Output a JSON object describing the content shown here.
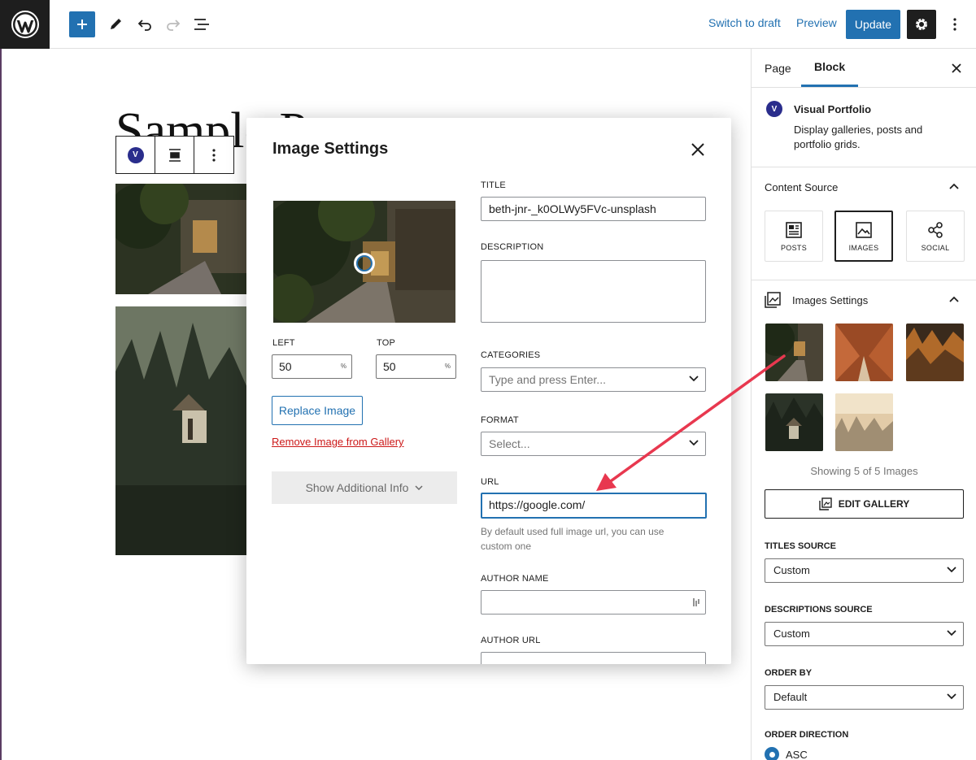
{
  "topbar": {
    "switch_to_draft": "Switch to draft",
    "preview": "Preview",
    "update": "Update"
  },
  "post": {
    "title": "Sample Post"
  },
  "modal": {
    "title": "Image Settings",
    "left_label": "LEFT",
    "left_value": "50",
    "top_label": "TOP",
    "top_value": "50",
    "unit": "%",
    "replace_button": "Replace Image",
    "remove_link": "Remove Image from Gallery",
    "additional_info_button": "Show Additional Info",
    "fields": {
      "title_label": "TITLE",
      "title_value": "beth-jnr-_k0OLWy5FVc-unsplash",
      "description_label": "DESCRIPTION",
      "description_value": "",
      "categories_label": "CATEGORIES",
      "categories_placeholder": "Type and press Enter...",
      "format_label": "FORMAT",
      "format_value": "Select...",
      "url_label": "URL",
      "url_value": "https://google.com/",
      "url_help": "By default used full image url, you can use custom one",
      "author_name_label": "AUTHOR NAME",
      "author_name_value": "",
      "author_url_label": "AUTHOR URL"
    }
  },
  "sidebar": {
    "tabs": [
      "Page",
      "Block"
    ],
    "active_tab": "Block",
    "block_name": "Visual Portfolio",
    "block_description": "Display galleries, posts and portfolio grids.",
    "content_source_heading": "Content Source",
    "sources": [
      "POSTS",
      "IMAGES",
      "SOCIAL"
    ],
    "active_source": "IMAGES",
    "images_settings_heading": "Images Settings",
    "showing_text": "Showing 5 of 5 Images",
    "edit_gallery_button": "EDIT GALLERY",
    "titles_source_label": "TITLES SOURCE",
    "titles_source_value": "Custom",
    "descriptions_source_label": "DESCRIPTIONS SOURCE",
    "descriptions_source_value": "Custom",
    "order_by_label": "ORDER BY",
    "order_by_value": "Default",
    "order_direction_label": "ORDER DIRECTION",
    "order_direction_value": "ASC"
  },
  "colors": {
    "accent": "#2271b1",
    "annotation_arrow": "#e8384f",
    "danger": "#cc1818"
  }
}
